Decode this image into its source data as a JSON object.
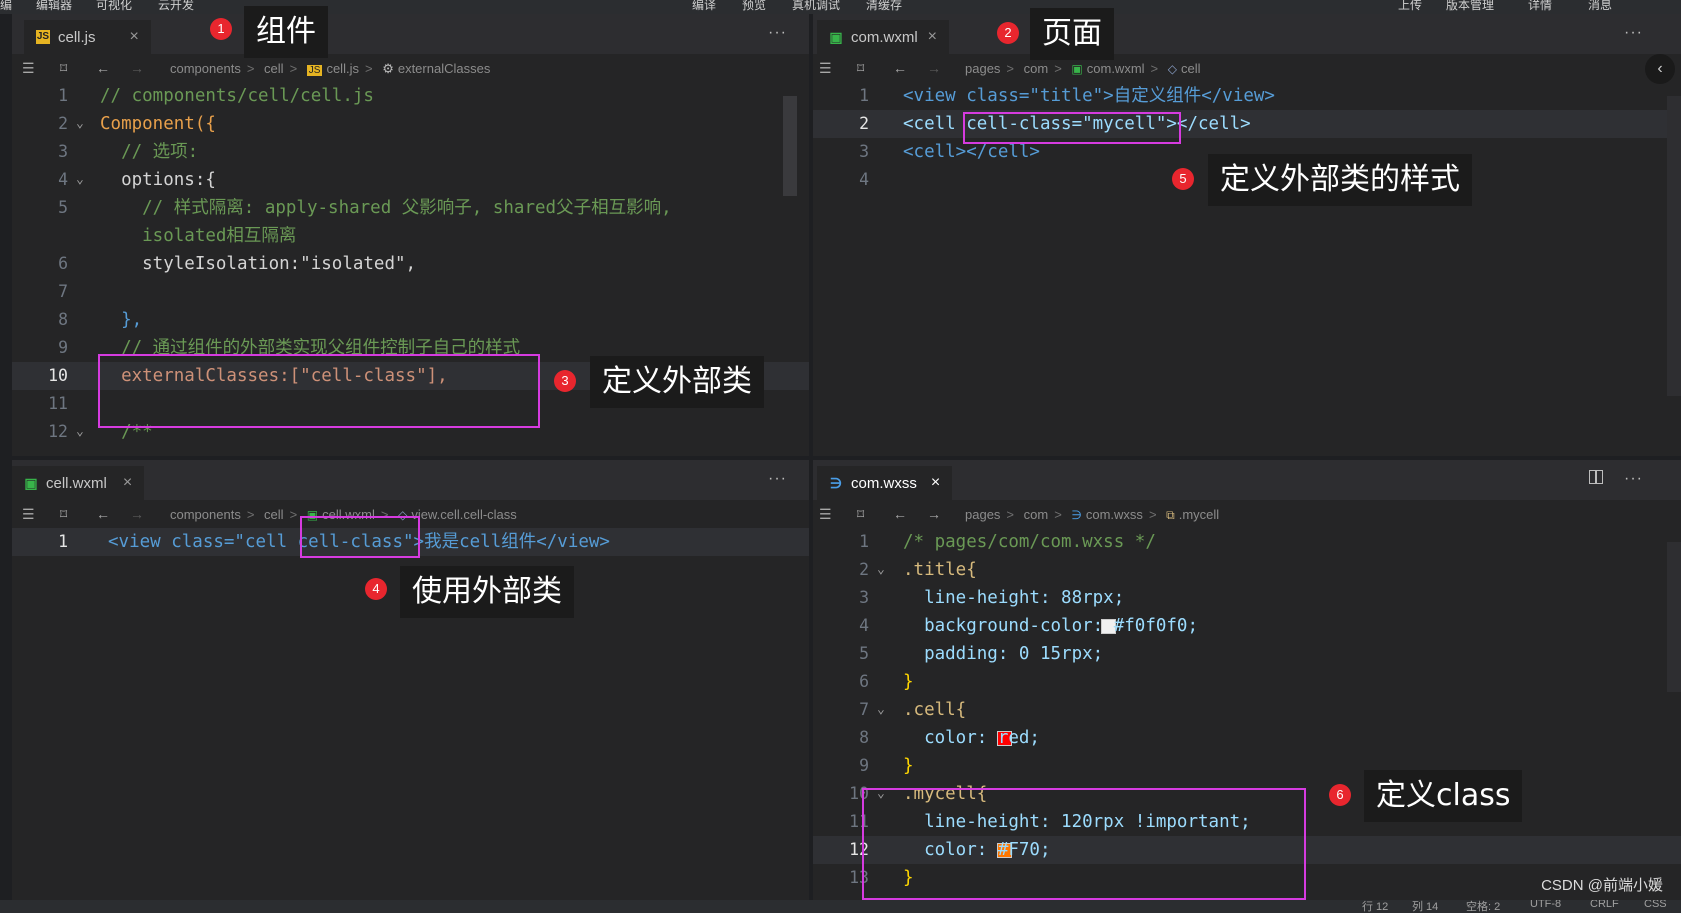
{
  "menubar": {
    "left": [
      "编辑器",
      "可视化",
      "云开发"
    ],
    "center": [
      "编译",
      "预览",
      "真机调试",
      "清缓存"
    ],
    "right": [
      "上传",
      "版本管理",
      "详情",
      "消息"
    ]
  },
  "panes": {
    "top_left": {
      "tab": {
        "label": "cell.js",
        "icon": "js-file-icon",
        "close": "×"
      },
      "breadcrumb": [
        "components",
        "cell",
        "cell.js",
        "externalClasses"
      ],
      "lines": [
        {
          "n": "1",
          "t": "// components/cell/cell.js"
        },
        {
          "n": "2",
          "t": "Component({"
        },
        {
          "n": "3",
          "t": "  // 选项:"
        },
        {
          "n": "4",
          "t": "  options:{"
        },
        {
          "n": "5",
          "t": "    // 样式隔离: apply-shared 父影响子, shared父子相互影响,"
        },
        {
          "n": "",
          "t": "    isolated相互隔离"
        },
        {
          "n": "6",
          "t": "    styleIsolation:\"isolated\","
        },
        {
          "n": "7",
          "t": ""
        },
        {
          "n": "8",
          "t": "  },"
        },
        {
          "n": "9",
          "t": "  // 通过组件的外部类实现父组件控制子自己的样式"
        },
        {
          "n": "10",
          "t": "  externalClasses:[\"cell-class\"],"
        },
        {
          "n": "11",
          "t": ""
        },
        {
          "n": "12",
          "t": "  /**"
        }
      ]
    },
    "top_right": {
      "tab": {
        "label": "com.wxml",
        "icon": "wxml-file-icon",
        "close": "×"
      },
      "breadcrumb": [
        "pages",
        "com",
        "com.wxml",
        "cell"
      ],
      "lines": [
        {
          "n": "1",
          "t": "<view class=\"title\">自定义组件</view>"
        },
        {
          "n": "2",
          "t": "<cell cell-class=\"mycell\"></cell>"
        },
        {
          "n": "3",
          "t": "<cell></cell>"
        },
        {
          "n": "4",
          "t": ""
        }
      ]
    },
    "bottom_left": {
      "tab": {
        "label": "cell.wxml",
        "icon": "wxml-file-icon",
        "close": "×"
      },
      "breadcrumb": [
        "components",
        "cell",
        "cell.wxml",
        "view.cell.cell-class"
      ],
      "lines": [
        {
          "n": "1",
          "t": "<view class=\"cell cell-class\">我是cell组件</view>"
        }
      ]
    },
    "bottom_right": {
      "tab": {
        "label": "com.wxss",
        "icon": "wxss-file-icon",
        "close": "×"
      },
      "breadcrumb": [
        "pages",
        "com",
        "com.wxss",
        ".mycell"
      ],
      "lines": [
        {
          "n": "1",
          "t": "/* pages/com/com.wxss */"
        },
        {
          "n": "2",
          "t": ".title{"
        },
        {
          "n": "3",
          "t": "  line-height: 88rpx;"
        },
        {
          "n": "4",
          "t": "  background-color: #f0f0f0;"
        },
        {
          "n": "5",
          "t": "  padding: 0 15rpx;"
        },
        {
          "n": "6",
          "t": "}"
        },
        {
          "n": "7",
          "t": ".cell{"
        },
        {
          "n": "8",
          "t": "  color: red;"
        },
        {
          "n": "9",
          "t": "}"
        },
        {
          "n": "10",
          "t": ".mycell{"
        },
        {
          "n": "11",
          "t": "  line-height: 120rpx !important;"
        },
        {
          "n": "12",
          "t": "  color: #F70;"
        },
        {
          "n": "13",
          "t": "}"
        }
      ]
    }
  },
  "callouts": [
    {
      "num": "1",
      "label": "组件"
    },
    {
      "num": "2",
      "label": "页面"
    },
    {
      "num": "3",
      "label": "定义外部类"
    },
    {
      "num": "4",
      "label": "使用外部类"
    },
    {
      "num": "5",
      "label": "定义外部类的样式"
    },
    {
      "num": "6",
      "label": "定义class"
    }
  ],
  "watermark": "CSDN @前端小媛",
  "statusbar": [
    "行 12",
    "列 14",
    "空格: 2",
    "UTF-8",
    "CRLF",
    "CSS"
  ],
  "colors": {
    "highlight_box": "#d63be0",
    "badge": "#e8262e",
    "red_swatch": "#ff0000",
    "orange_swatch": "#ff7700",
    "light_swatch": "#f0f0f0"
  }
}
